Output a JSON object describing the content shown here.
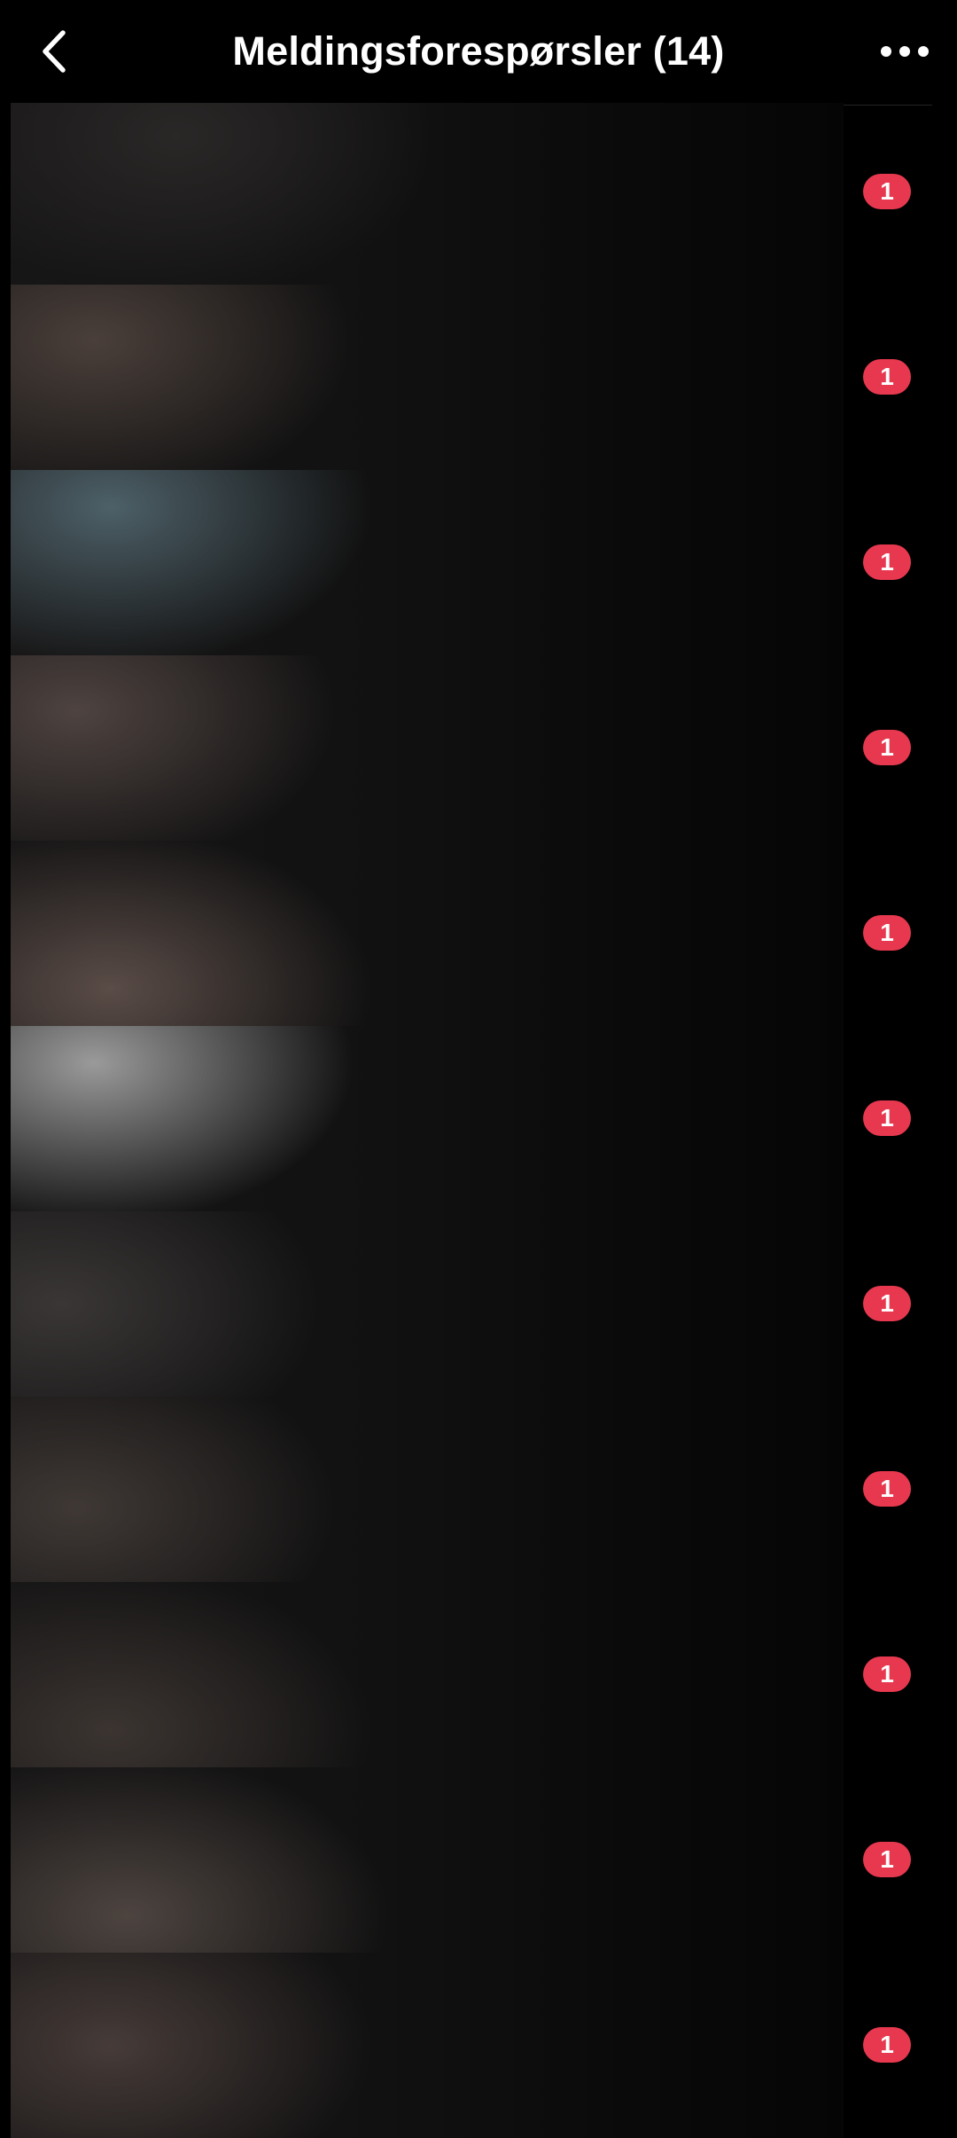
{
  "header": {
    "title": "Meldingsforespørsler (14)",
    "back_icon": "chevron-left-icon",
    "more_icon": "more-horizontal-icon"
  },
  "theme": {
    "background": "#000000",
    "badge_color": "#e8384f",
    "text_color": "#ffffff"
  },
  "requests": [
    {
      "unread_count": "1",
      "tint": "#2a2727"
    },
    {
      "unread_count": "1",
      "tint": "#4a3f3a"
    },
    {
      "unread_count": "1",
      "tint": "#4d6068"
    },
    {
      "unread_count": "1",
      "tint": "#4e4340"
    },
    {
      "unread_count": "1",
      "tint": "#5a4c47"
    },
    {
      "unread_count": "1",
      "tint": "#9a9a9a"
    },
    {
      "unread_count": "1",
      "tint": "#3a3636"
    },
    {
      "unread_count": "1",
      "tint": "#3f3835"
    },
    {
      "unread_count": "1",
      "tint": "#3b3431"
    },
    {
      "unread_count": "1",
      "tint": "#4d4440"
    },
    {
      "unread_count": "1",
      "tint": "#463b38"
    }
  ]
}
